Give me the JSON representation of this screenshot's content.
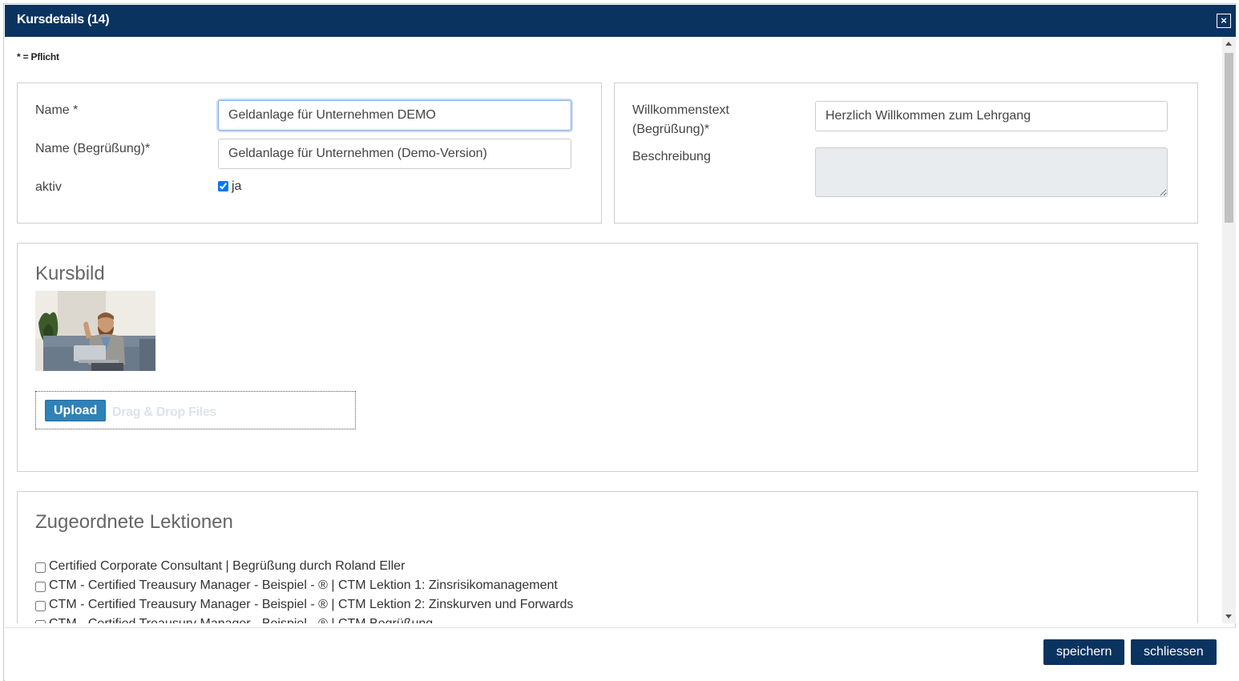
{
  "dialog": {
    "title": "Kursdetails (14)",
    "close_label": "×"
  },
  "required_note": "* = Pflicht",
  "form": {
    "name_label": "Name *",
    "name_value": "Geldanlage für Unternehmen DEMO",
    "greeting_name_label": "Name (Begrüßung)*",
    "greeting_name_value": "Geldanlage für Unternehmen (Demo-Version)",
    "active_label": "aktiv",
    "active_checked": true,
    "active_option_label": "ja",
    "welcome_label_line1": "Willkommenstext",
    "welcome_label_line2": "(Begrüßung)*",
    "welcome_value": "Herzlich Willkommen zum Lehrgang",
    "description_label": "Beschreibung",
    "description_value": ""
  },
  "course_image": {
    "section_title": "Kursbild",
    "upload_label": "Upload",
    "dragdrop_label": "Drag & Drop Files"
  },
  "lessons": {
    "section_title": "Zugeordnete Lektionen",
    "items": [
      {
        "label": "Certified Corporate Consultant | Begrüßung durch Roland Eller",
        "checked": false
      },
      {
        "label": "CTM - Certified Treausury Manager - Beispiel - ® | CTM Lektion 1: Zinsrisikomanagement",
        "checked": false
      },
      {
        "label": "CTM - Certified Treausury Manager - Beispiel - ® | CTM Lektion 2: Zinskurven und Forwards",
        "checked": false
      },
      {
        "label": "CTM - Certified Treausury Manager - Beispiel - ® | CTM Begrüßung",
        "checked": false
      }
    ]
  },
  "footer": {
    "save_label": "speichern",
    "close_label": "schliessen"
  },
  "colors": {
    "header_bg": "#0b3360",
    "upload_btn": "#2f82b8"
  }
}
